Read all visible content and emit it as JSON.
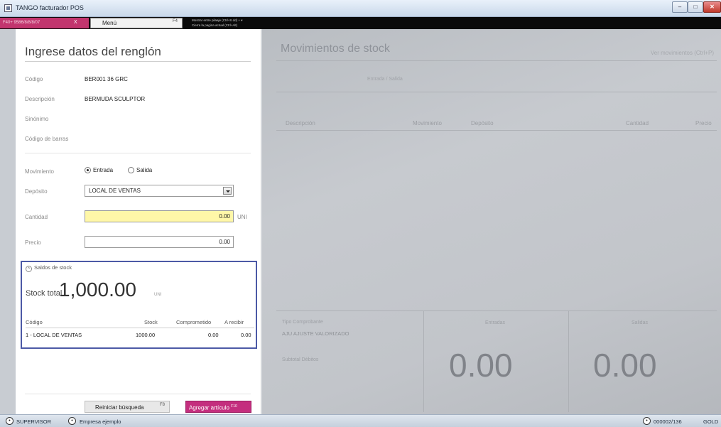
{
  "window": {
    "title": "TANGO facturador POS",
    "min_label": "–",
    "max_label": "□",
    "close_label": "✕"
  },
  "toolbar": {
    "barcode_text": "F40+ 9586/8/8/8/07",
    "barcode_clear": "X",
    "menu_label": "Menú",
    "menu_key": "F4",
    "hint_line1": "Mostrar entre pilaaje (Ctrl+S dd) + ▾",
    "hint_line2": "Cierra la pagina actual (Ctrl+Alt)"
  },
  "form": {
    "title": "Ingrese datos del renglón",
    "codigo_label": "Código",
    "codigo_value": "BER001  36 GRC",
    "descripcion_label": "Descripción",
    "descripcion_value": "BERMUDA SCULPTOR",
    "sinonimo_label": "Sinónimo",
    "barras_label": "Código de barras",
    "movimiento_label": "Movimiento",
    "entrada_label": "Entrada",
    "salida_label": "Salida",
    "movimiento_selected": "Entrada",
    "deposito_label": "Depósito",
    "deposito_value": "LOCAL DE VENTAS",
    "cantidad_label": "Cantidad",
    "cantidad_value": "0.00",
    "cantidad_unit": "UNI",
    "precio_label": "Precio",
    "precio_value": "0.00"
  },
  "stock": {
    "toggle_label": "Saldos de stock",
    "toggle_icon": "chevron-up-icon",
    "total_label": "Stock total",
    "total_value": "1,000.00",
    "total_unit": "UNI",
    "columns": [
      "Código",
      "Stock",
      "Comprometido",
      "A recibir"
    ],
    "rows": [
      [
        "1 - LOCAL DE VENTAS",
        "1000.00",
        "0.00",
        "0.00"
      ]
    ]
  },
  "actions": {
    "reset_label": "Reiniciar búsqueda",
    "reset_key": "F8",
    "add_label": "Agregar artículo",
    "add_key": "F10"
  },
  "movements": {
    "title": "Movimientos de stock",
    "hint": "Ver movimientos (Ctrl+P)",
    "subtitle": "Entrada / Salida",
    "columns": [
      "Descripción",
      "Movimiento",
      "Depósito",
      "Cantidad",
      "Precio"
    ],
    "tipo_label": "Tipo Comprobante",
    "tipo_value": "AJU AJUSTE VALORIZADO",
    "subtotal_label": "Subtotal Débitos",
    "entradas_label": "Entradas",
    "salidas_label": "Salidas",
    "entradas_value": "0.00",
    "salidas_value": "0.00"
  },
  "statusbar": {
    "user": "SUPERVISOR",
    "company": "Empresa ejemplo",
    "doc": "000002/136",
    "extra": "GOLD"
  },
  "colors": {
    "accent": "#c42e7e",
    "highlight_border": "#4c59a6",
    "input_yellow": "#fff7a8"
  }
}
